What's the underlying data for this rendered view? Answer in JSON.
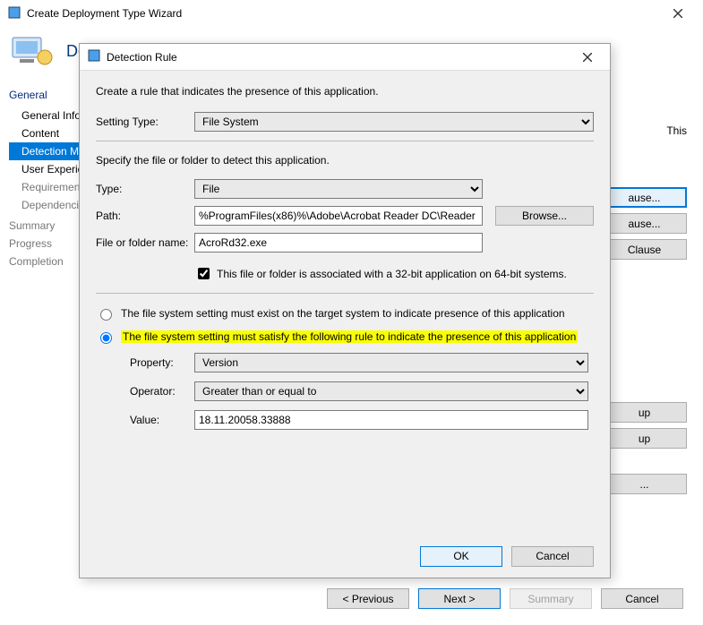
{
  "outer": {
    "title": "Create Deployment Type Wizard",
    "header_label_partial": "De"
  },
  "nav": {
    "general_group": "General",
    "general_info": "General Info",
    "content": "Content",
    "detection": "Detection M",
    "user_exp": "User Experie",
    "requirements": "Requirement",
    "dependencies": "Dependenci",
    "summary": "Summary",
    "progress": "Progress",
    "completion": "Completion"
  },
  "right": {
    "this_label": "This",
    "btn_ause1": "ause...",
    "btn_ause2": "ause...",
    "btn_clause": "Clause",
    "btn_up1": "up",
    "btn_up2": "up",
    "ellipsis": "..."
  },
  "footer": {
    "previous": "< Previous",
    "next": "Next >",
    "summary": "Summary",
    "cancel": "Cancel"
  },
  "dialog": {
    "title": "Detection Rule",
    "intro": "Create a rule that indicates the presence of this application.",
    "setting_type_label": "Setting Type:",
    "setting_type_value": "File System",
    "specify": "Specify the file or folder to detect this application.",
    "type_label": "Type:",
    "type_value": "File",
    "path_label": "Path:",
    "path_value": "%ProgramFiles(x86)%\\Adobe\\Acrobat Reader DC\\Reader",
    "browse": "Browse...",
    "name_label": "File or folder name:",
    "name_value": "AcroRd32.exe",
    "chk_label": "This file or folder is associated with a 32-bit application on 64-bit systems.",
    "radio1": "The file system setting must exist on the target system to indicate presence of this application",
    "radio2": "The file system setting must satisfy the following rule to indicate the presence of this application",
    "property_label": "Property:",
    "property_value": "Version",
    "operator_label": "Operator:",
    "operator_value": "Greater than or equal to",
    "value_label": "Value:",
    "value_value": "18.11.20058.33888",
    "ok": "OK",
    "cancel": "Cancel"
  }
}
